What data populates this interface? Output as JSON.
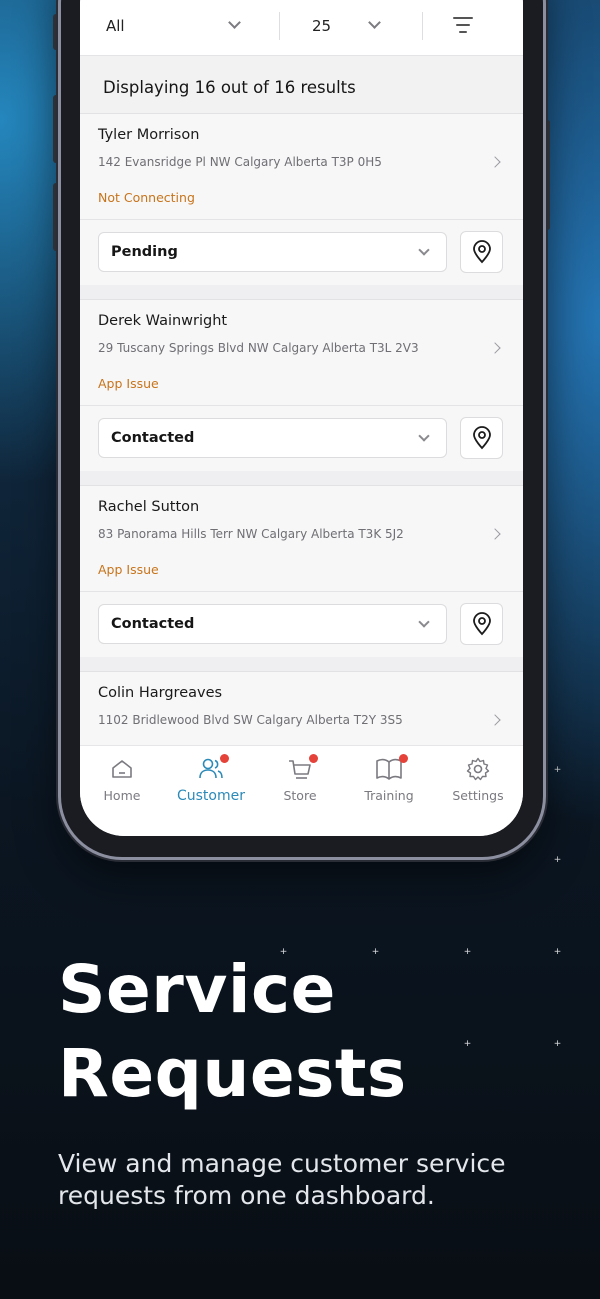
{
  "filters": {
    "status_value": "All",
    "page_size_value": "25"
  },
  "results_text": "Displaying 16 out of 16 results",
  "customers": [
    {
      "name": "Tyler Morrison",
      "address": "142 Evansridge Pl NW Calgary Alberta T3P 0H5",
      "issue": "Not Connecting",
      "status": "Pending"
    },
    {
      "name": "Derek Wainwright",
      "address": "29 Tuscany Springs Blvd NW Calgary Alberta T3L 2V3",
      "issue": "App Issue",
      "status": "Contacted"
    },
    {
      "name": "Rachel Sutton",
      "address": "83 Panorama Hills Terr NW Calgary Alberta T3K 5J2",
      "issue": "App Issue",
      "status": "Contacted"
    },
    {
      "name": "Colin Hargreaves",
      "address": "1102 Bridlewood Blvd SW Calgary Alberta T2Y 3S5"
    }
  ],
  "tabs": [
    {
      "label": "Home",
      "icon": "home-icon"
    },
    {
      "label": "Customer",
      "icon": "users-icon"
    },
    {
      "label": "Store",
      "icon": "cart-icon"
    },
    {
      "label": "Training",
      "icon": "book-icon"
    },
    {
      "label": "Settings",
      "icon": "gear-icon"
    }
  ],
  "headline": {
    "line1": "Service",
    "line2": "Requests"
  },
  "subtitle": "View and manage customer service requests from one dashboard.",
  "colors": {
    "accent": "#2b8ab8",
    "issue": "#c8741a",
    "badge": "#e5423a"
  }
}
